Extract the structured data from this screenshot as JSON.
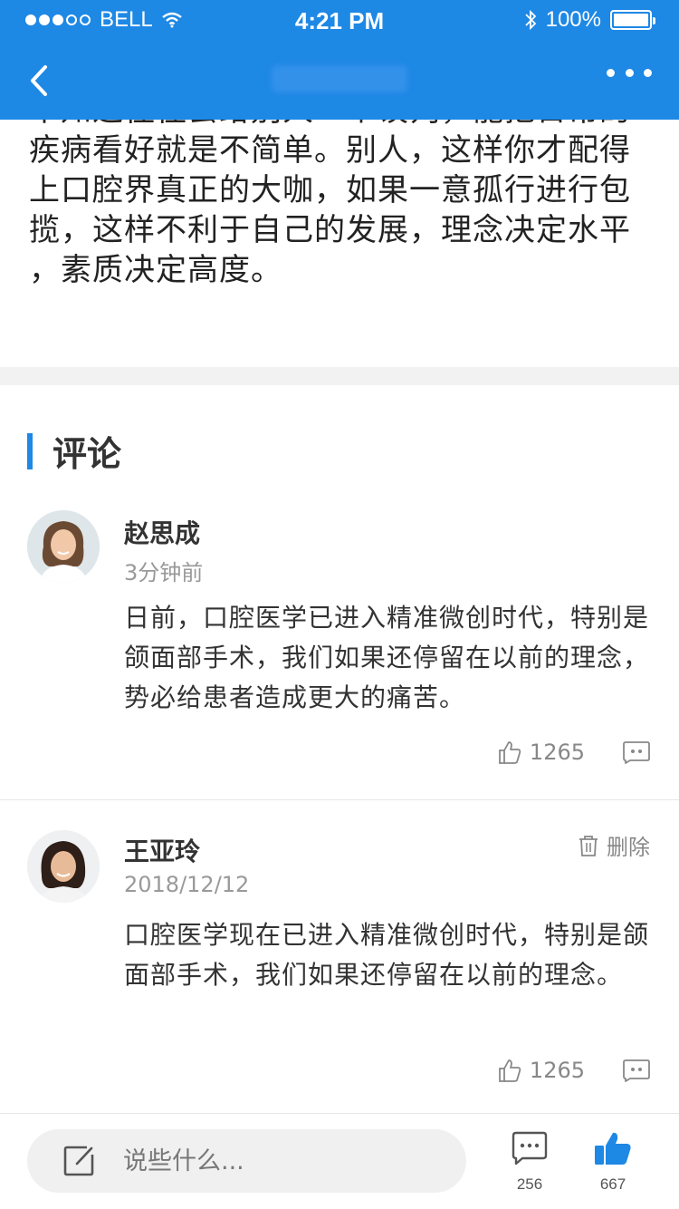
{
  "status_bar": {
    "carrier": "BELL",
    "time": "4:21 PM",
    "battery": "100%"
  },
  "article": {
    "lines": [
      "不知这往往会给别人一个误判，能把日常的",
      "疾病看好就是不简单。别人，这样你才配得",
      "上口腔界真正的大咖，如果一意孤行进行包",
      "揽，这样不利于自己的发展，理念决定水平",
      "，素质决定高度。"
    ]
  },
  "comments_section": {
    "title": "评论",
    "accent_color": "#1e88e5",
    "comments": [
      {
        "name": "赵思成",
        "time": "3分钟前",
        "text": "日前，口腔医学已进入精准微创时代，特别是颌面部手术，我们如果还停留在以前的理念，势必给患者造成更大的痛苦。",
        "likes": "1265"
      },
      {
        "name": "王亚玲",
        "time": "2018/12/12",
        "text": "口腔医学现在已进入精准微创时代，特别是颌面部手术，我们如果还停留在以前的理念。",
        "likes": "1265",
        "delete_label": "删除"
      }
    ]
  },
  "bottom_bar": {
    "input_placeholder": "说些什么...",
    "comment_count": "256",
    "like_count": "667"
  },
  "icons": {
    "back": "chevron-left-icon",
    "more": "more-dots-icon",
    "like": "thumbs-up-icon",
    "reply": "message-icon",
    "delete": "trash-icon",
    "edit": "edit-icon",
    "comment": "comment-bubble-icon"
  },
  "colors": {
    "header": "#1e88e5",
    "like_active": "#1e88e5"
  }
}
